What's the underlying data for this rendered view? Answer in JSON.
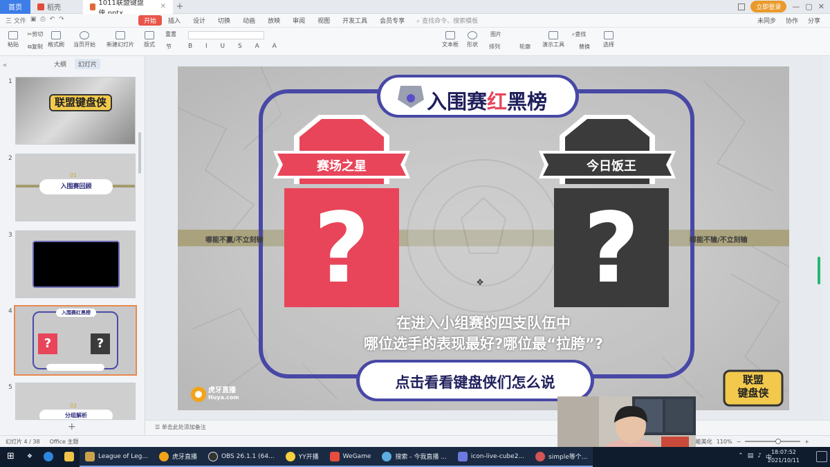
{
  "tabs": {
    "home": "首页",
    "doc": "稻壳",
    "file": "1011联盟键盘侠.pptx",
    "login": "立即登录"
  },
  "menu": {
    "items": [
      "三 文件",
      "开始",
      "插入",
      "设计",
      "切换",
      "动画",
      "放映",
      "审阅",
      "视图",
      "开发工具",
      "会员专享"
    ],
    "active": "开始",
    "search": "查找命令、搜索模板",
    "right": [
      "未同步",
      "协作",
      "分享"
    ]
  },
  "ribbon": {
    "buttons": [
      "粘贴",
      "剪切",
      "复制",
      "格式刷",
      "当页开始",
      "新建幻灯片",
      "版式",
      "节",
      "重置",
      "文本框",
      "形状",
      "排列",
      "图片",
      "轮廓",
      "查找",
      "演示工具",
      "替换",
      "选择"
    ]
  },
  "left_panel": {
    "tab_outline": "大纲",
    "tab_slides": "幻灯片",
    "slides": [
      {
        "num": "1",
        "title": "联盟键盘侠"
      },
      {
        "num": "2",
        "title": "入围赛回顾",
        "sub": "01"
      },
      {
        "num": "3",
        "title": ""
      },
      {
        "num": "4",
        "title": "入围赛红黑榜"
      },
      {
        "num": "5",
        "title": "分组解析",
        "sub": "02"
      }
    ]
  },
  "slide": {
    "title_prefix": "入围赛",
    "title_red": "红",
    "title_suffix": "黑榜",
    "left_banner": "赛场之星",
    "right_banner": "今日饭王",
    "question_mark": "?",
    "body_line1": "在进入小组赛的四支队伍中",
    "body_line2": "哪位选手的表现最好?哪位最“拉胯”?",
    "cta": "点击看看键盘侠们怎么说",
    "strip_left": "哪能不赢/不立刻输",
    "strip_right": "哪能不输/不立刻输",
    "huya_cn": "虎牙直播",
    "huya_en": "Huya.com",
    "logo_text_top": "联盟",
    "logo_text_bottom": "键盘侠",
    "colors": {
      "red": "#e8455a",
      "dark": "#3b3b3b",
      "navy": "#3d3d9a"
    }
  },
  "notes": "单击此处添加备注",
  "status": {
    "slide_counter": "幻灯片 4 / 38",
    "theme": "Office 主题",
    "zoom": "110%",
    "smart_beautify": "智能美化"
  },
  "taskbar": {
    "apps": [
      "League of Leg...",
      "虎牙直播",
      "OBS 26.1.1 (64...",
      "YY开播",
      "WeGame",
      "搜索 - 今我直播 ...",
      "icon-live-cube2...",
      "simple等个..."
    ],
    "ime": "中",
    "time": "18:07:52",
    "date": "2021/10/11"
  }
}
